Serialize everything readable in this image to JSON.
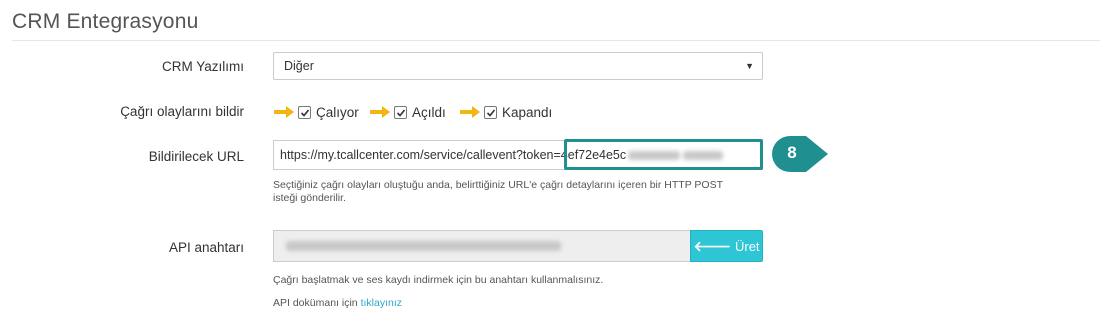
{
  "section": {
    "title": "CRM Entegrasyonu"
  },
  "crm_software": {
    "label": "CRM Yazılımı",
    "selected": "Diğer"
  },
  "call_events": {
    "label": "Çağrı olaylarını bildir",
    "options": [
      {
        "label": "Çalıyor",
        "checked": true
      },
      {
        "label": "Açıldı",
        "checked": true
      },
      {
        "label": "Kapandı",
        "checked": true
      }
    ],
    "arrow_color": "#f5b50f"
  },
  "notify_url": {
    "label": "Bildirilecek URL",
    "value_visible": "https://my.tcallcenter.com/service/callevent?token=4ef72e4e5c",
    "help": "Seçtiğiniz çağrı olayları oluştuğu anda, belirttiğiniz URL'e çağrı detaylarını içeren bir HTTP POST isteği gönderilir.",
    "highlight_color": "#1f8f8f"
  },
  "callout": {
    "number": "8",
    "color": "#1f8f8f"
  },
  "api_key": {
    "label": "API anahtarı",
    "button_label": "Üret",
    "button_icon": "arrow-left-icon",
    "button_color": "#2ec5d4",
    "help": "Çağrı başlatmak ve ses kaydı indirmek için bu anahtarı kullanmalısınız.",
    "doc_prefix": "API dokümanı için",
    "doc_link": "tıklayınız"
  }
}
